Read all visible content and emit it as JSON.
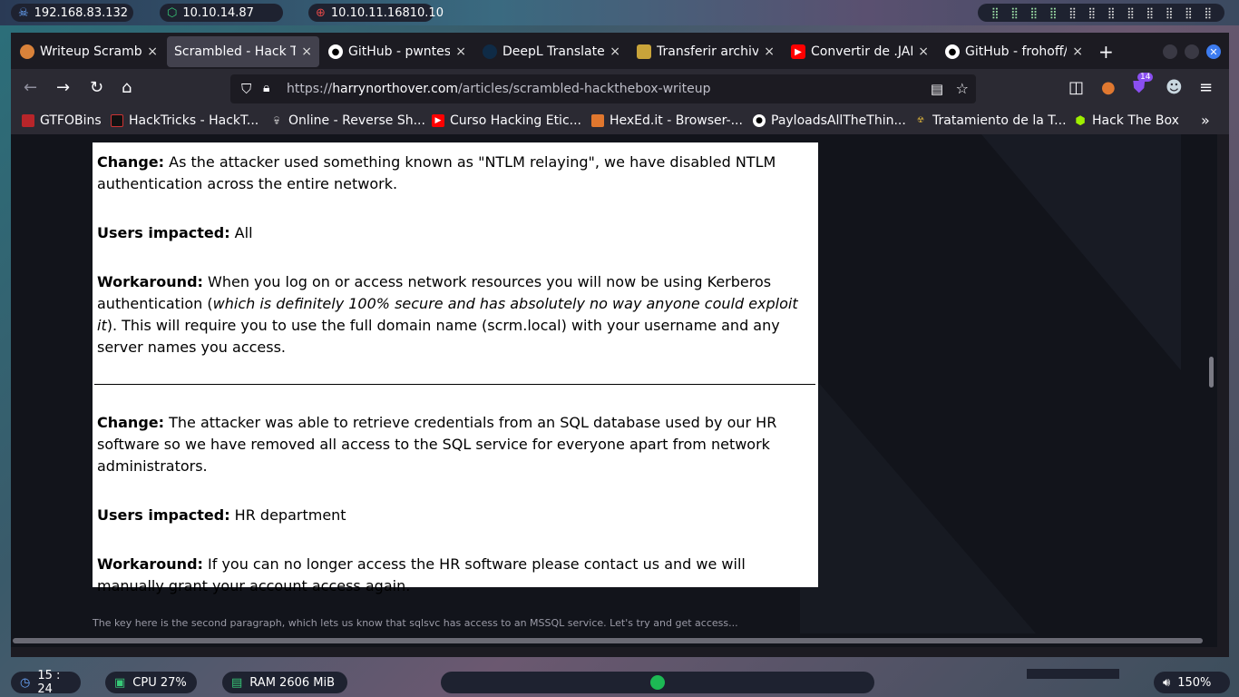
{
  "topbar": {
    "ip_local": "192.168.83.132",
    "ip_vpn": "10.10.14.87",
    "ip_target": "10.10.11.16810.10",
    "workspaces": [
      "⣿",
      "⣿",
      "⣿",
      "⣿",
      "⣿",
      "⣿",
      "⣿",
      "⣿",
      "⣿",
      "⣿",
      "⣿",
      "⣿"
    ]
  },
  "browser": {
    "tabs": [
      {
        "label": "Writeup Scrambled",
        "icon": "writeup-favicon"
      },
      {
        "label": "Scrambled - Hack The",
        "icon": "none"
      },
      {
        "label": "GitHub - pwntester",
        "icon": "github-icon"
      },
      {
        "label": "DeepL Translate",
        "icon": "deepl-icon"
      },
      {
        "label": "Transferir archivos",
        "icon": "ironman-icon"
      },
      {
        "label": "Convertir de .JAR",
        "icon": "youtube-icon"
      },
      {
        "label": "GitHub - frohoff/y",
        "icon": "github-icon"
      }
    ],
    "url_prefix": "https://",
    "url_domain": "harrynorthover.com",
    "url_path": "/articles/scrambled-hackthebox-writeup",
    "extension_badge": "14",
    "bookmarks": [
      "GTFOBins",
      "HackTricks - HackT...",
      "Online - Reverse Sh...",
      "Curso Hacking Etic...",
      "HexEd.it - Browser-...",
      "PayloadsAllTheThin...",
      "Tratamiento de la T...",
      "Hack The Box"
    ]
  },
  "article": {
    "block1_change_label": "Change:",
    "block1_change_text": " As the attacker used something known as \"NTLM relaying\", we have disabled NTLM authentication across the entire network.",
    "block1_users_label": "Users impacted:",
    "block1_users_text": " All",
    "block1_work_label": "Workaround:",
    "block1_work_text_a": " When you log on or access network resources you will now be using Kerberos authentication (",
    "block1_work_italic": "which is definitely 100% secure and has absolutely no way anyone could exploit it",
    "block1_work_text_b": "). This will require you to use the full domain name (scrm.local) with your username and any server names you access.",
    "block2_change_label": "Change:",
    "block2_change_text": " The attacker was able to retrieve credentials from an SQL database used by our HR software so we have removed all access to the SQL service for everyone apart from network administrators.",
    "block2_users_label": "Users impacted:",
    "block2_users_text": " HR department",
    "block2_work_label": "Workaround:",
    "block2_work_text": " If you can no longer access the HR software please contact us and we will manually grant your account access again.",
    "caption": "The key here is the second paragraph, which lets us know that sqlsvc has access to an MSSQL service. Let's try and get access..."
  },
  "bottombar": {
    "time": "15 : 24",
    "cpu": "CPU 27%",
    "ram": "RAM 2606 MiB",
    "volume": "150%"
  }
}
